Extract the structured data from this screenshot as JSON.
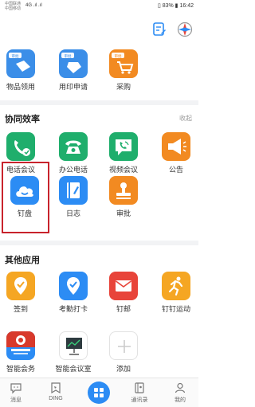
{
  "status_bar": {
    "carrier_line1": "中国联通",
    "carrier_line2": "中国移动",
    "signal": "4G .ıl .ıl",
    "battery": "83%",
    "time": "16:42"
  },
  "top_icons": [
    "edit-list-icon",
    "compass-icon"
  ],
  "section_top": {
    "apps": [
      {
        "label": "物品领用",
        "color": "#3b8ee8",
        "badge": "审批",
        "icon": "box-icon"
      },
      {
        "label": "用印申请",
        "color": "#3b8ee8",
        "badge": "审批",
        "icon": "seal-icon"
      },
      {
        "label": "采购",
        "color": "#f28a21",
        "badge": "审批",
        "icon": "cart-icon"
      }
    ]
  },
  "section_collab": {
    "title": "协同效率",
    "collapse": "收起",
    "apps": [
      {
        "label": "电话会议",
        "color": "#1fae6c",
        "icon": "phone-meeting-icon"
      },
      {
        "label": "办公电话",
        "color": "#1fae6c",
        "icon": "desk-phone-icon"
      },
      {
        "label": "视频会议",
        "color": "#1fae6c",
        "icon": "video-call-icon"
      },
      {
        "label": "公告",
        "color": "#f28a21",
        "icon": "megaphone-icon"
      },
      {
        "label": "钉盘",
        "color": "#2c8cf4",
        "icon": "cloud-drive-icon"
      },
      {
        "label": "日志",
        "color": "#2c8cf4",
        "icon": "journal-icon"
      },
      {
        "label": "审批",
        "color": "#f28a21",
        "icon": "stamp-icon"
      }
    ]
  },
  "section_other": {
    "title": "其他应用",
    "apps": [
      {
        "label": "签到",
        "color": "#f5a623",
        "icon": "checkin-icon"
      },
      {
        "label": "考勤打卡",
        "color": "#2c8cf4",
        "icon": "location-check-icon"
      },
      {
        "label": "钉邮",
        "color": "#e8443a",
        "icon": "mail-icon"
      },
      {
        "label": "钉钉运动",
        "color": "#f5a623",
        "icon": "running-icon"
      },
      {
        "label": "智能会务",
        "color": "#2c8cf4",
        "icon": "conference-icon"
      },
      {
        "label": "智能会议室",
        "color": "#ffffff",
        "icon": "meeting-room-icon"
      },
      {
        "label": "添加",
        "color": "#ffffff",
        "icon": "add-icon"
      }
    ]
  },
  "bottom_nav": {
    "tabs": [
      {
        "label": "消息",
        "icon": "chat-icon"
      },
      {
        "label": "DING",
        "icon": "ding-icon"
      },
      {
        "label": "",
        "icon": "work-grid-icon"
      },
      {
        "label": "通讯录",
        "icon": "contacts-icon"
      },
      {
        "label": "我的",
        "icon": "profile-icon"
      }
    ]
  }
}
